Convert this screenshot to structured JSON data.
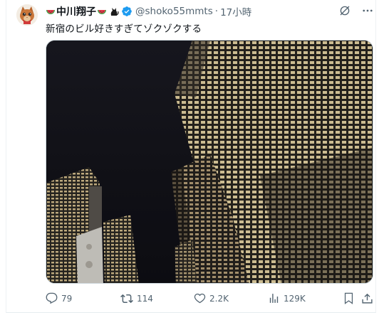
{
  "tweet": {
    "display_name": "中川翔子",
    "handle": "@shoko55mmts",
    "separator": "·",
    "time": "17小時",
    "text": "新宿のビル好きすぎてゾクゾクする",
    "verified_color": "#1d9bf0",
    "name_emojis": [
      "watermelon-emoji",
      "watermelon-emoji",
      "black-cat-emoji"
    ]
  },
  "actions": {
    "replies": "79",
    "retweets": "114",
    "likes": "2.2K",
    "views": "129K"
  },
  "header_icons": [
    "grok-icon",
    "more-icon"
  ],
  "action_icons": [
    "reply-icon",
    "retweet-icon",
    "like-icon",
    "views-icon",
    "bookmark-icon",
    "share-icon"
  ]
}
